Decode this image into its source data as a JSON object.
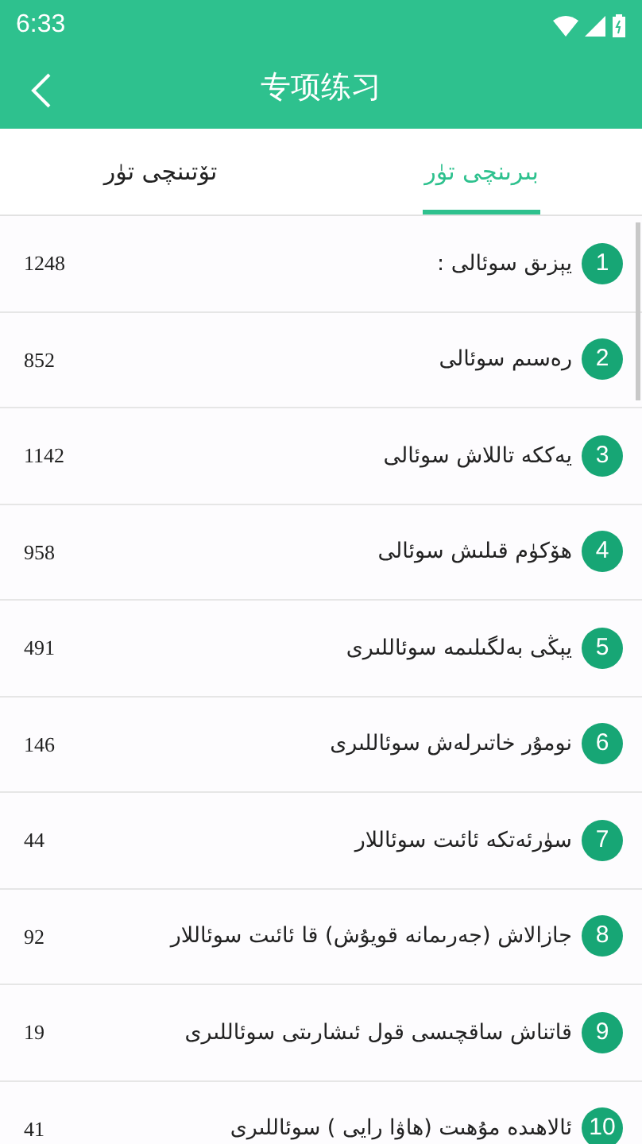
{
  "status_bar": {
    "time": "6:33"
  },
  "app_bar": {
    "title": "专项练习"
  },
  "tabs": [
    {
      "label": "بىرىنچى تۈر",
      "selected": true
    },
    {
      "label": "تۆتىنچى تۈر",
      "selected": false
    }
  ],
  "items": [
    {
      "index": "1",
      "title": "يېزىق سوئالى :",
      "count": "1248"
    },
    {
      "index": "2",
      "title": "رەسىم سوئالى",
      "count": "852"
    },
    {
      "index": "3",
      "title": "يەككە تاللاش سوئالى",
      "count": "1142"
    },
    {
      "index": "4",
      "title": "ھۆكۈم قىلىش سوئالى",
      "count": "958"
    },
    {
      "index": "5",
      "title": "يېڭى بەلگىلىمە سوئاللىرى",
      "count": "491"
    },
    {
      "index": "6",
      "title": "نومۇر خاتىرلەش سوئاللىرى",
      "count": "146"
    },
    {
      "index": "7",
      "title": "سۈرئەتكە ئائىت سوئاللار",
      "count": "44"
    },
    {
      "index": "8",
      "title": "جازالاش (جەرىمانە قويۇش) قا ئائىت سوئاللار",
      "count": "92"
    },
    {
      "index": "9",
      "title": "قاتناش ساقچىسى قول ئىشارىتى سوئاللىرى",
      "count": "19"
    },
    {
      "index": "10",
      "title": "ئالاھىدە مۇھىت (ھاۋا رايى ) سوئاللىرى",
      "count": "41"
    }
  ]
}
